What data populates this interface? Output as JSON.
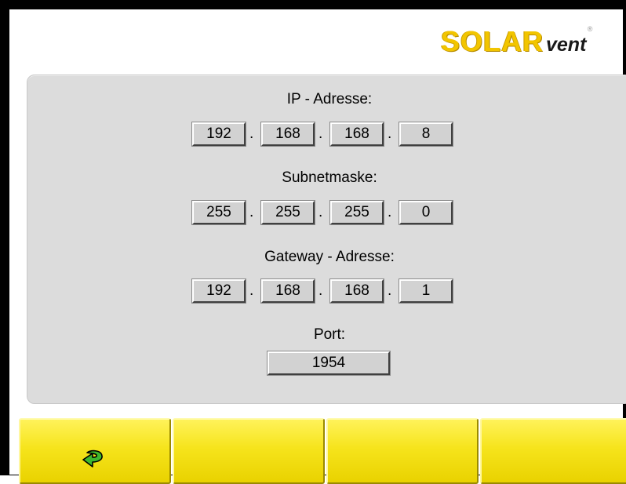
{
  "brand": {
    "logo_part1": "SOLAR",
    "logo_part2": "vent",
    "logo_mark": "®",
    "color_solar": "#f2c500",
    "color_vent": "#1a1a1a"
  },
  "network": {
    "ip_label": "IP - Adresse:",
    "ip": [
      "192",
      "168",
      "168",
      "8"
    ],
    "subnet_label": "Subnetmaske:",
    "subnet": [
      "255",
      "255",
      "255",
      "0"
    ],
    "gateway_label": "Gateway - Adresse:",
    "gateway": [
      "192",
      "168",
      "168",
      "1"
    ],
    "port_label": "Port:",
    "port": "1954",
    "separator": "."
  },
  "softkeys": [
    {
      "icon": "back-arrow-icon",
      "label": ""
    },
    {
      "icon": "",
      "label": ""
    },
    {
      "icon": "",
      "label": ""
    },
    {
      "icon": "",
      "label": ""
    }
  ],
  "colors": {
    "softkey_yellow": "#f6e41c",
    "panel_bg": "#dcdcdc",
    "field_bg": "#d2d2d2",
    "icon_green": "#3db82e"
  }
}
